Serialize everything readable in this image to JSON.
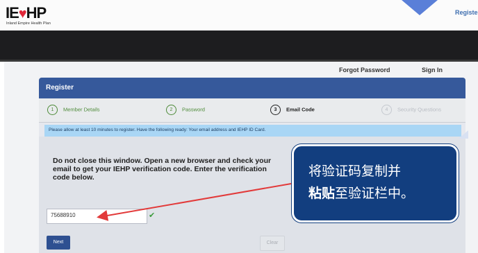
{
  "header": {
    "logo_text_1": "IE",
    "logo_heart": "♥",
    "logo_text_2": "HP",
    "logo_subtitle": "Inland Empire Health Plan",
    "register_link": "Register"
  },
  "nav": {
    "forgot_password": "Forgot Password",
    "sign_in": "Sign In"
  },
  "panel": {
    "title": "Register",
    "steps": [
      {
        "number": "1",
        "label": "Member Details",
        "status": "complete"
      },
      {
        "number": "2",
        "label": "Password",
        "status": "complete"
      },
      {
        "number": "3",
        "label": "Email Code",
        "status": "active"
      },
      {
        "number": "4",
        "label": "Security Questions",
        "status": "pending"
      }
    ],
    "info_text": "Please allow at least 10 minutes to register. Have the following ready: Your email address and IEHP ID Card.",
    "instruction": "Do not close this window. Open a new browser and check your email to get your IEHP verification code. Enter the verification code below.",
    "code_value": "75688910",
    "next_label": "Next",
    "clear_label": "Clear"
  },
  "callout": {
    "line1": "将验证码复制并",
    "line2_bold": "粘贴",
    "line2_rest": "至验证栏中。"
  },
  "colors": {
    "brand_blue": "#36599b",
    "callout_bg": "#123e7f",
    "arrow_red": "#e23a3a",
    "complete_green": "#4c8a37"
  }
}
